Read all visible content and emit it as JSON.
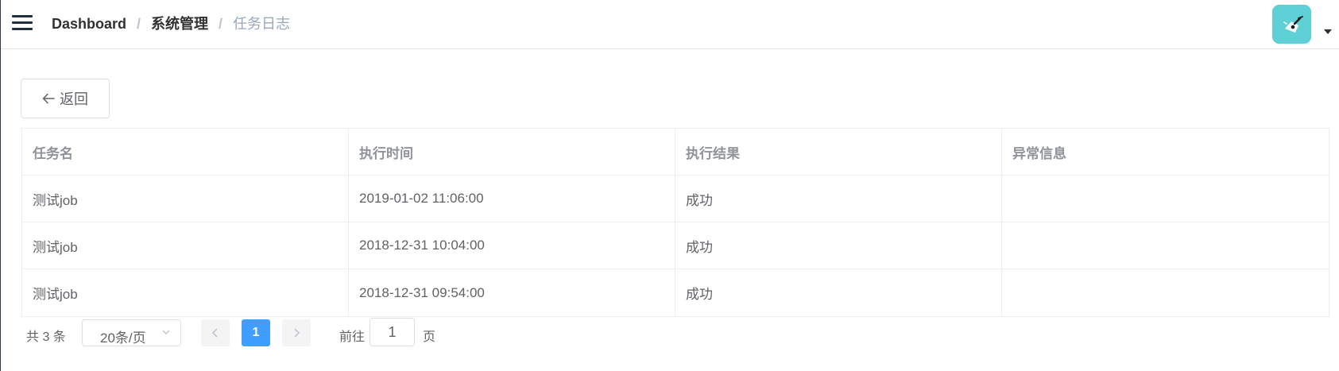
{
  "navbar": {
    "breadcrumb": [
      {
        "label": "Dashboard"
      },
      {
        "label": "系统管理"
      },
      {
        "label": "任务日志"
      }
    ],
    "separator": "/"
  },
  "back_button": {
    "label": "返回"
  },
  "table": {
    "columns": [
      "任务名",
      "执行时间",
      "执行结果",
      "异常信息"
    ],
    "rows": [
      [
        "测试job",
        "2019-01-02 11:06:00",
        "成功",
        ""
      ],
      [
        "测试job",
        "2018-12-31 10:04:00",
        "成功",
        ""
      ],
      [
        "测试job",
        "2018-12-31 09:54:00",
        "成功",
        ""
      ]
    ]
  },
  "pagination": {
    "total_text": "共 3 条",
    "page_size": "20条/页",
    "current_page": "1",
    "goto_prefix": "前往",
    "goto_value": "1",
    "goto_suffix": "页",
    "accent": "#409eff"
  }
}
